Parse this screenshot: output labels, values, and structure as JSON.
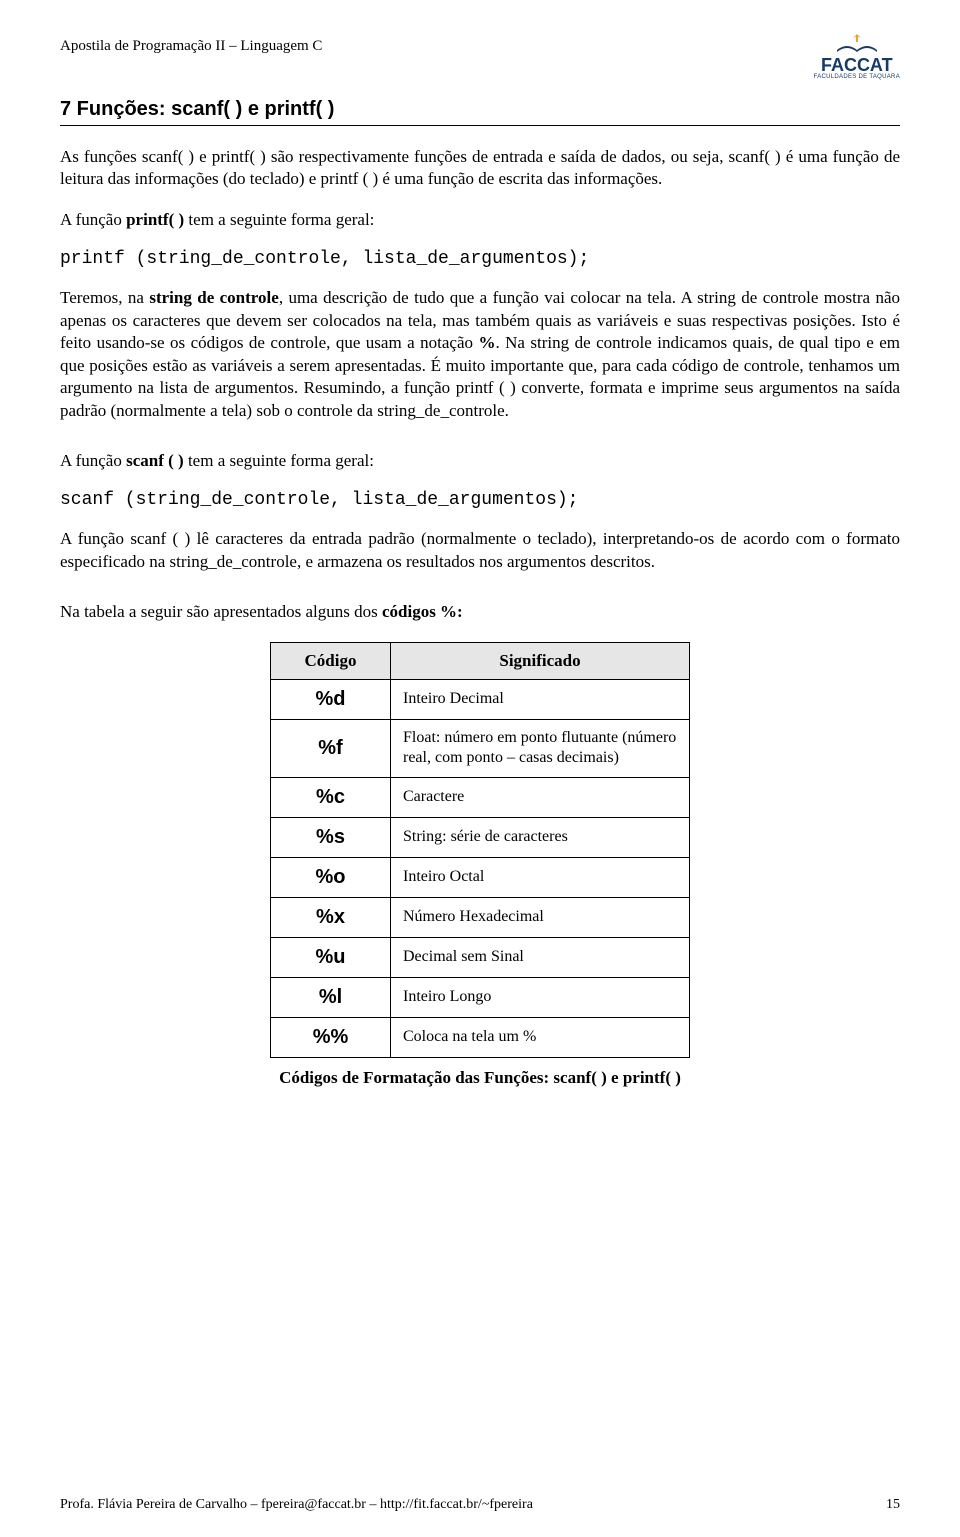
{
  "header": {
    "doc_title": "Apostila de Programação II – Linguagem C",
    "logo_main": "FACCAT",
    "logo_sub": "FACULDADES DE TAQUARA"
  },
  "section_heading": "7  Funções:  scanf( )  e  printf( )",
  "para1_html": "As funções scanf( ) e printf( ) são respectivamente funções de entrada e saída de dados, ou seja, scanf( ) é uma função de leitura das informações (do teclado) e printf ( ) é uma função de escrita das informações.",
  "para2_html": "A função <b>printf( )</b> tem a seguinte forma geral:",
  "code1": "printf (string_de_controle, lista_de_argumentos);",
  "para3_html": "Teremos, na <b>string de controle</b>, uma descrição de tudo que a função vai colocar na tela. A string de controle mostra não apenas os caracteres que devem ser colocados na tela, mas também quais as variáveis e suas respectivas posições. Isto é feito usando-se os códigos de controle, que usam a notação <b>%</b>. Na string de controle indicamos quais, de qual tipo e em que posições estão as variáveis a serem apresentadas. É muito importante que, para cada código de controle, tenhamos um argumento na lista de argumentos. Resumindo, a função printf ( ) converte, formata e imprime seus argumentos na saída padrão (normalmente a tela) sob o controle da string_de_controle.",
  "para4_html": "A função <b>scanf ( )</b> tem a seguinte forma geral:",
  "code2": "scanf (string_de_controle, lista_de_argumentos);",
  "para5_html": "A função scanf ( ) lê caracteres da entrada padrão (normalmente o teclado), interpretando-os de acordo com o formato especificado na string_de_controle, e armazena os resultados nos argumentos descritos.",
  "para6_html": "Na tabela a seguir são apresentados alguns dos <b>códigos %:</b>",
  "table": {
    "head_code": "Código",
    "head_mean": "Significado",
    "rows": [
      {
        "code": "%d",
        "mean": "Inteiro Decimal"
      },
      {
        "code": "%f",
        "mean": "Float: número em ponto flutuante (número real, com ponto – casas decimais)"
      },
      {
        "code": "%c",
        "mean": "Caractere"
      },
      {
        "code": "%s",
        "mean": "String: série de caracteres"
      },
      {
        "code": "%o",
        "mean": "Inteiro Octal"
      },
      {
        "code": "%x",
        "mean": "Número Hexadecimal"
      },
      {
        "code": "%u",
        "mean": "Decimal sem Sinal"
      },
      {
        "code": "%l",
        "mean": "Inteiro Longo"
      },
      {
        "code": "%%",
        "mean": "Coloca na tela um %"
      }
    ],
    "caption": "Códigos de Formatação das Funções: scanf( ) e printf( )"
  },
  "footer": {
    "left": "Profa. Flávia Pereira de Carvalho – fpereira@faccat.br – http://fit.faccat.br/~fpereira",
    "right": "15"
  }
}
